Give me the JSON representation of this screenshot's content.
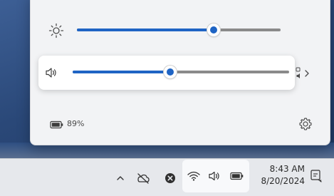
{
  "quick_settings": {
    "brightness": {
      "icon": "brightness-icon",
      "level": 0.67
    },
    "volume": {
      "icon": "volume-icon",
      "level": 0.45,
      "device_switch_icon": "audio-output-switch-icon"
    },
    "battery": {
      "icon": "battery-icon",
      "percent_label": "89%"
    },
    "settings_icon": "gear-icon"
  },
  "taskbar": {
    "tray_items": [
      {
        "name": "show-hidden-icons",
        "icon": "chevron-up-icon"
      },
      {
        "name": "onedrive",
        "icon": "cloud-off-icon"
      },
      {
        "name": "app-tray",
        "icon": "x-circle-icon"
      },
      {
        "name": "network",
        "icon": "wifi-icon"
      },
      {
        "name": "volume",
        "icon": "speaker-icon"
      },
      {
        "name": "battery",
        "icon": "battery-icon"
      }
    ],
    "clock": {
      "time": "8:43 AM",
      "date": "8/20/2024"
    },
    "notifications_icon": "notification-icon"
  },
  "colors": {
    "accent": "#1f64c4",
    "panel_bg": "#f2f3f5",
    "taskbar_bg": "#e6e8ec"
  }
}
